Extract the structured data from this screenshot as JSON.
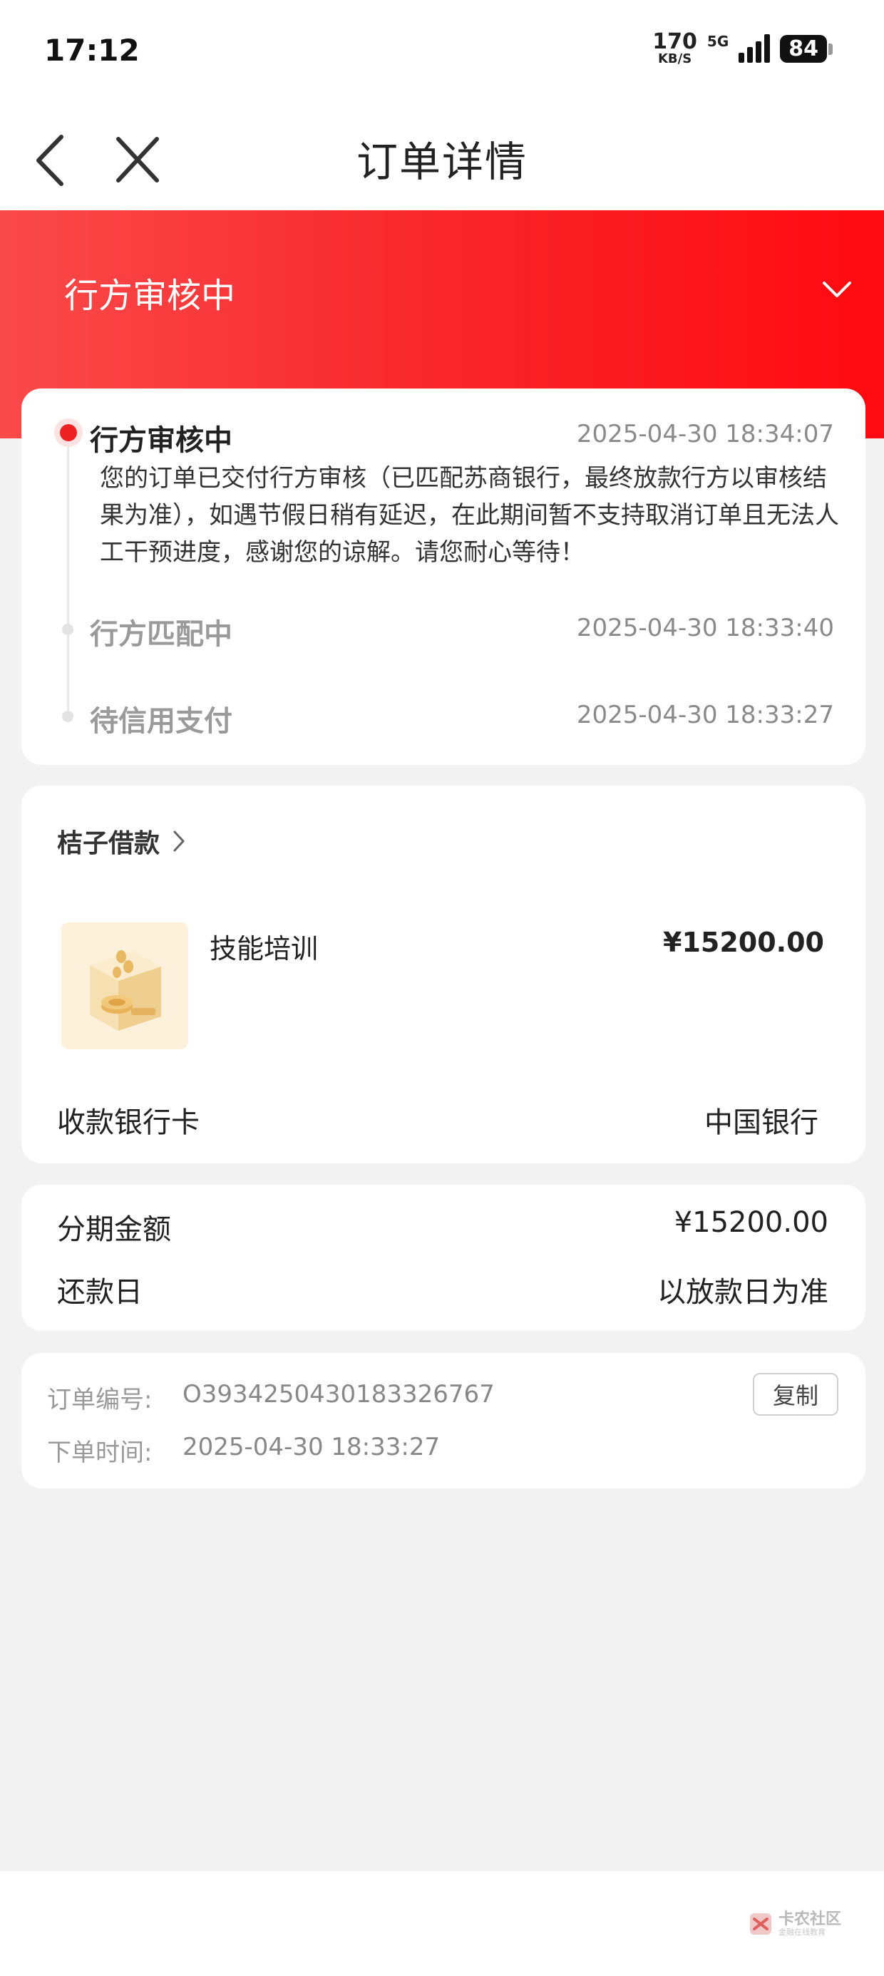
{
  "status_bar": {
    "time": "17:12",
    "speed_value": "170",
    "speed_unit": "KB/S",
    "network": "5G",
    "battery": "84"
  },
  "nav": {
    "title": "订单详情",
    "back_icon": "chevron-left-icon",
    "close_icon": "close-icon"
  },
  "hero": {
    "status_title": "行方审核中",
    "expand_icon": "chevron-down-icon"
  },
  "timeline": [
    {
      "title": "行方审核中",
      "time": "2025-04-30 18:34:07",
      "description": "您的订单已交付行方审核（已匹配苏商银行，最终放款行方以审核结果为准），如遇节假日稍有延迟，在此期间暂不支持取消订单且无法人工干预进度，感谢您的谅解。请您耐心等待！"
    },
    {
      "title": "行方匹配中",
      "time": "2025-04-30 18:33:40"
    },
    {
      "title": "待信用支付",
      "time": "2025-04-30 18:33:27"
    }
  ],
  "product_card": {
    "merchant": "桔子借款",
    "product_name": "技能培训",
    "price": "¥15200.00",
    "bank_label": "收款银行卡",
    "bank_value": "中国银行"
  },
  "installment": {
    "amount_label": "分期金额",
    "amount_value": "¥15200.00",
    "repay_label": "还款日",
    "repay_value": "以放款日为准"
  },
  "order_info": {
    "order_no_label": "订单编号:",
    "order_no_value": "O3934250430183326767",
    "copy_label": "复制",
    "order_time_label": "下单时间:",
    "order_time_value": "2025-04-30 18:33:27"
  },
  "watermark": {
    "text": "卡农社区",
    "sub": "金融在线教育"
  },
  "colors": {
    "accent": "#f8262a",
    "page_bg": "#f2f2f2"
  }
}
